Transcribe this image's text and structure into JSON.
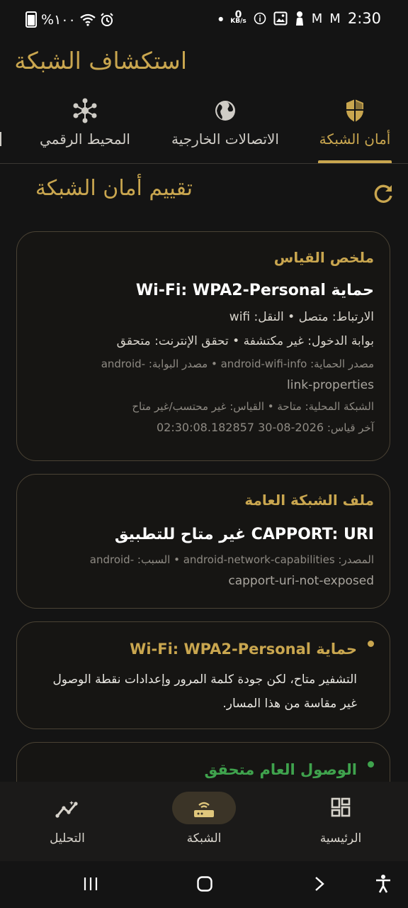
{
  "status_bar": {
    "battery": "%١٠٠",
    "time": "2:30",
    "net_speed": "0",
    "net_unit": "KB/s"
  },
  "app": {
    "title": "استكشاف الشبكة"
  },
  "tabs": [
    {
      "label": "أمان الشبكة",
      "icon": "shield-icon",
      "active": true
    },
    {
      "label": "الاتصالات الخارجية",
      "icon": "globe-icon",
      "active": false
    },
    {
      "label": "المحيط الرقمي",
      "icon": "hub-icon",
      "active": false
    }
  ],
  "page": {
    "title": "تقييم أمان الشبكة",
    "refresh_icon": "refresh-icon"
  },
  "card1": {
    "heading": "ملخص القياس",
    "protection_prefix": "حماية",
    "protection_value": "Wi-Fi: WPA2-Personal",
    "line1": "الارتباط: متصل  •  النقل: wifi",
    "line2": "بوابة الدخول: غير مكتشفة  •  تحقق الإنترنت: متحقق",
    "line3": "مصدر الحماية: android-wifi-info  •  مصدر البوابة: -android",
    "line3b": "link-properties",
    "line4": "الشبكة المحلية: متاحة  •  القياس: غير محتسب/غير متاح",
    "last_label": "آخر قياس:",
    "last_value": "02:30:08.182857 30-08-2026"
  },
  "card2": {
    "heading": "ملف الشبكة العامة",
    "title": "CAPPORT: URI غير متاح للتطبيق",
    "line1": "المصدر: android-network-capabilities  •  السبب: -android",
    "line1b": "capport-uri-not-exposed"
  },
  "card3": {
    "prefix": "حماية",
    "value": "Wi-Fi: WPA2-Personal",
    "body": "التشفير متاح، لكن جودة كلمة المرور وإعدادات نقطة الوصول غير مقاسة من هذا المسار.",
    "dot_color": "#c9a64f"
  },
  "card4": {
    "title": "الوصول العام متحقق",
    "dot_color": "#3fa34d"
  },
  "bottom_nav": [
    {
      "label": "التحليل",
      "icon": "analytics-icon"
    },
    {
      "label": "الشبكة",
      "icon": "router-icon",
      "active": true
    },
    {
      "label": "الرئيسية",
      "icon": "dashboard-icon"
    }
  ],
  "colors": {
    "accent": "#c9a64f",
    "background": "#141414",
    "success": "#3fa34d"
  }
}
